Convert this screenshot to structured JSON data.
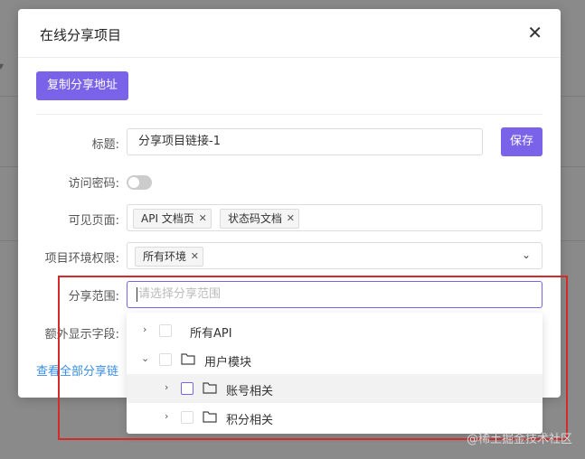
{
  "modal": {
    "title": "在线分享项目",
    "close": "✕",
    "copy_button": "复制分享地址",
    "save_button": "保存",
    "view_all_link": "查看全部分享链"
  },
  "form": {
    "title_label": "标题:",
    "title_value": "分享项目链接-1",
    "password_label": "访问密码:",
    "password_enabled": false,
    "pages_label": "可见页面:",
    "pages": [
      "API 文档页",
      "状态码文档"
    ],
    "env_label": "项目环境权限:",
    "envs": [
      "所有环境"
    ],
    "scope_label": "分享范围:",
    "scope_placeholder": "请选择分享范围",
    "extra_label": "额外显示字段:"
  },
  "tree": {
    "items": [
      {
        "label": "所有API",
        "expanded": false,
        "folder": false
      },
      {
        "label": "用户模块",
        "expanded": true,
        "folder": true
      },
      {
        "label": "账号相关",
        "expanded": false,
        "folder": true
      },
      {
        "label": "积分相关",
        "expanded": false,
        "folder": true
      }
    ]
  },
  "watermark": "@稀土掘金技术社区",
  "icons": {
    "close": "close-icon",
    "tag_remove": "tag-close-icon",
    "dropdown": "chevron-down-icon",
    "expand": "chevron-right-icon",
    "folder": "folder-icon"
  },
  "colors": {
    "primary": "#7a63e8",
    "link": "#3a8ee6",
    "annotation": "#d42a2a"
  }
}
